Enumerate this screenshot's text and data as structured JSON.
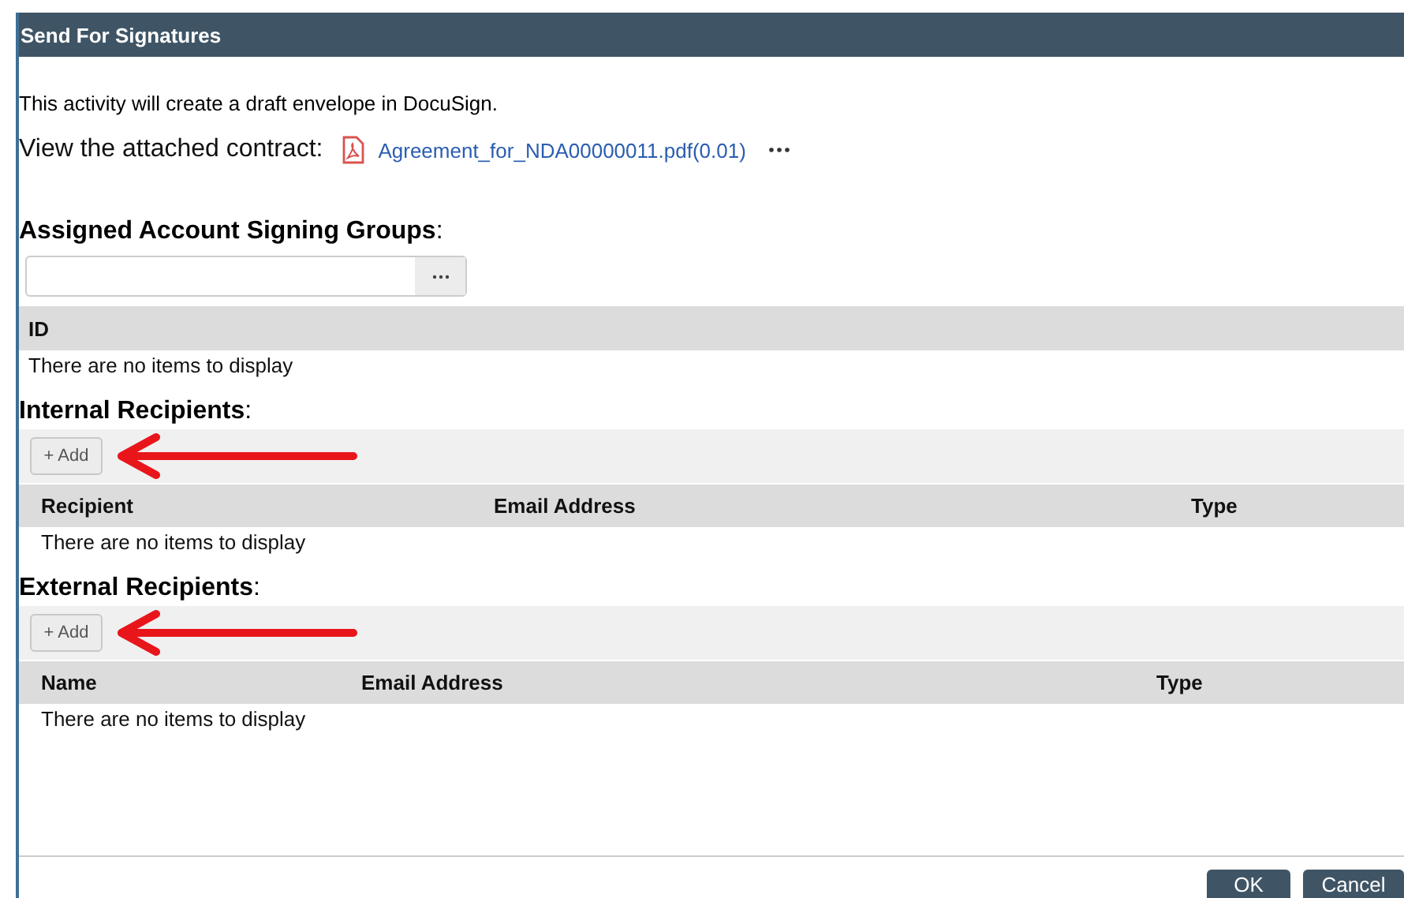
{
  "window": {
    "title": "Send For Signatures"
  },
  "intro": "This activity will create a draft envelope in DocuSign.",
  "contract": {
    "label": "View the attached contract:",
    "file": "Agreement_for_NDA00000011.pdf(0.01)"
  },
  "signing_groups": {
    "heading": "**Assigned Account Signing Groups**:",
    "columns": [
      "ID"
    ],
    "empty": "There are no items to display"
  },
  "sections": [
    {
      "heading": "**Internal Recipients**:",
      "add_button": "+ Add",
      "columns": [
        {
          "label": "Recipient"
        },
        {
          "label": "Email Address"
        },
        {
          "label": "Type"
        }
      ],
      "empty": "There are no items to display"
    },
    {
      "heading": "**External Recipients**:",
      "add_button": "+ Add",
      "columns": [
        {
          "label": "Name"
        },
        {
          "label": "Email Address"
        },
        {
          "label": "Type"
        }
      ],
      "empty": "There are no items to display"
    }
  ],
  "buttons": [
    "OK",
    "Cancel"
  ]
}
